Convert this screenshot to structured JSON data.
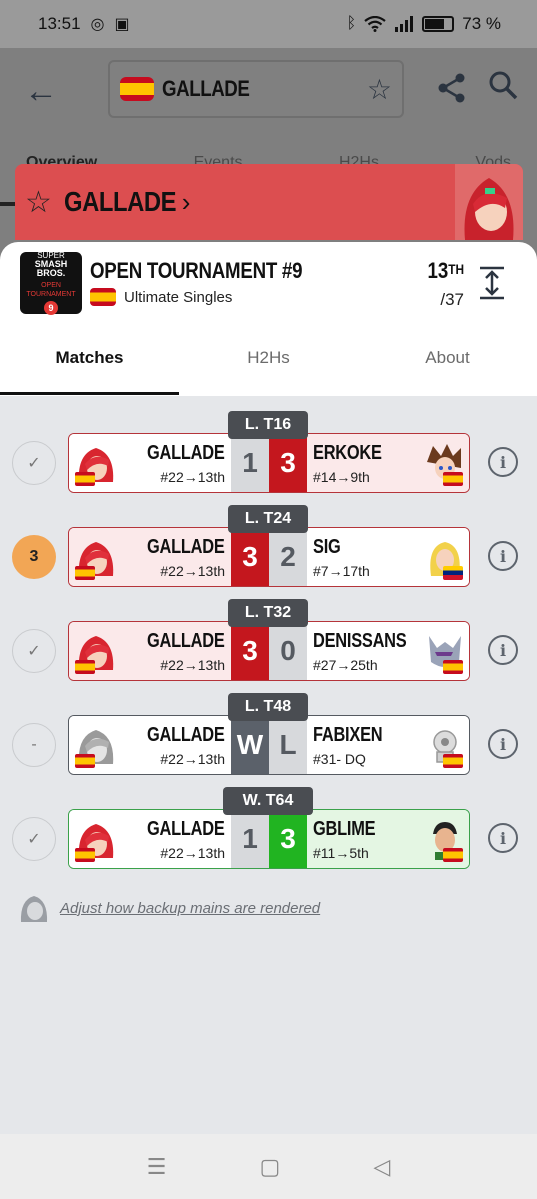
{
  "status_bar": {
    "time": "13:51",
    "battery": "73 %",
    "battery_level": 0.73
  },
  "app_bar": {
    "search_value": "GALLADE",
    "tabs": [
      "Overview",
      "Events",
      "H2Hs",
      "Vods"
    ]
  },
  "player_bar": {
    "name": "GALLADE"
  },
  "tournament": {
    "logo_line1": "SUPER",
    "logo_line2": "SMASH BROS.",
    "logo_line3": "OPEN TOURNAMENT",
    "logo_num": "9",
    "name": "OPEN TOURNAMENT #9",
    "event": "Ultimate Singles",
    "placement": "13",
    "placement_suffix": "TH",
    "total": "/37"
  },
  "tabs": [
    "Matches",
    "H2Hs",
    "About"
  ],
  "matches": [
    {
      "round": "L. T16",
      "status": "✓",
      "p1": "GALLADE",
      "p1_seed": "#22→13th",
      "s1": "1",
      "s2": "3",
      "p2": "ERKOKE",
      "p2_seed": "#14→9th"
    },
    {
      "round": "L. T24",
      "status": "3",
      "p1": "GALLADE",
      "p1_seed": "#22→13th",
      "s1": "3",
      "s2": "2",
      "p2": "SIG",
      "p2_seed": "#7→17th"
    },
    {
      "round": "L. T32",
      "status": "✓",
      "p1": "GALLADE",
      "p1_seed": "#22→13th",
      "s1": "3",
      "s2": "0",
      "p2": "DENISSANS",
      "p2_seed": "#27→25th"
    },
    {
      "round": "L. T48",
      "status": "-",
      "p1": "GALLADE",
      "p1_seed": "#22→13th",
      "s1": "W",
      "s2": "L",
      "p2": "FABIXEN",
      "p2_seed": "#31- DQ"
    },
    {
      "round": "W. T64",
      "status": "✓",
      "p1": "GALLADE",
      "p1_seed": "#22→13th",
      "s1": "1",
      "s2": "3",
      "p2": "GBLIME",
      "p2_seed": "#11→5th"
    }
  ],
  "note": "Adjust how backup mains are rendered",
  "colors": {
    "accent_red": "#dc4e50",
    "score_red": "#c4171e",
    "score_green": "#21b421",
    "status_orange": "#f2a655"
  }
}
